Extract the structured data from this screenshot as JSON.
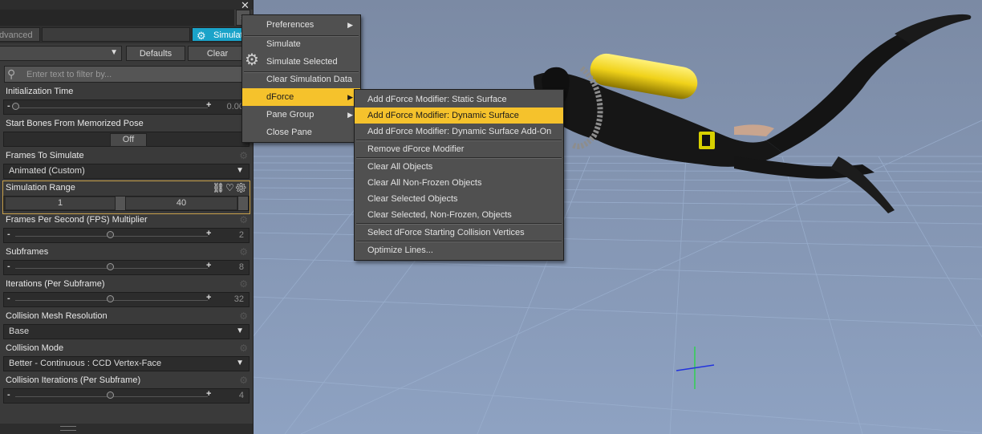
{
  "pane": {
    "close_glyph": "✕",
    "menu_glyph": "≡",
    "tabs": {
      "advanced": "dvanced",
      "simulation": "Simulat"
    },
    "defaults_label": "Defaults",
    "clear_label": "Clear",
    "filter_placeholder": "Enter text to filter by...",
    "props": {
      "init_time": {
        "label": "Initialization Time",
        "value": "0.00",
        "level": 0.0
      },
      "start_bones": {
        "label": "Start Bones From Memorized Pose",
        "value": "Off"
      },
      "frames_to_simulate": {
        "label": "Frames To Simulate",
        "value": "Animated (Custom)"
      },
      "sim_range": {
        "label": "Simulation Range",
        "start": "1",
        "end": "40"
      },
      "fps_mult": {
        "label": "Frames Per Second (FPS) Multiplier",
        "value": "2",
        "level": 0.5
      },
      "subframes": {
        "label": "Subframes",
        "value": "8",
        "level": 0.5
      },
      "iterations": {
        "label": "Iterations (Per Subframe)",
        "value": "32",
        "level": 0.5
      },
      "collision_res": {
        "label": "Collision Mesh Resolution",
        "value": "Base"
      },
      "collision_mode": {
        "label": "Collision Mode",
        "value": "Better - Continuous : CCD Vertex-Face"
      },
      "collision_iter": {
        "label": "Collision Iterations (Per Subframe)",
        "value": "4",
        "level": 0.5
      }
    }
  },
  "main_menu": {
    "preferences": "Preferences",
    "simulate": "Simulate",
    "simulate_selected": "Simulate Selected",
    "clear_sim_data": "Clear Simulation Data",
    "dforce": "dForce",
    "pane_group": "Pane Group",
    "close_pane": "Close Pane"
  },
  "dforce_menu": {
    "items": [
      "Add dForce Modifier: Static Surface",
      "Add dForce Modifier: Dynamic Surface",
      "Add dForce Modifier: Dynamic Surface Add-On",
      "Remove dForce Modifier",
      "Clear All Objects",
      "Clear All Non-Frozen Objects",
      "Clear Selected Objects",
      "Clear Selected, Non-Frozen, Objects",
      "Select dForce Starting Collision Vertices",
      "Optimize Lines..."
    ],
    "selected_index": 1
  },
  "colors": {
    "menu_highlight": "#f5c22c",
    "tab_active": "#1aa3c9",
    "viewport_bg": "#7a8ca8"
  }
}
